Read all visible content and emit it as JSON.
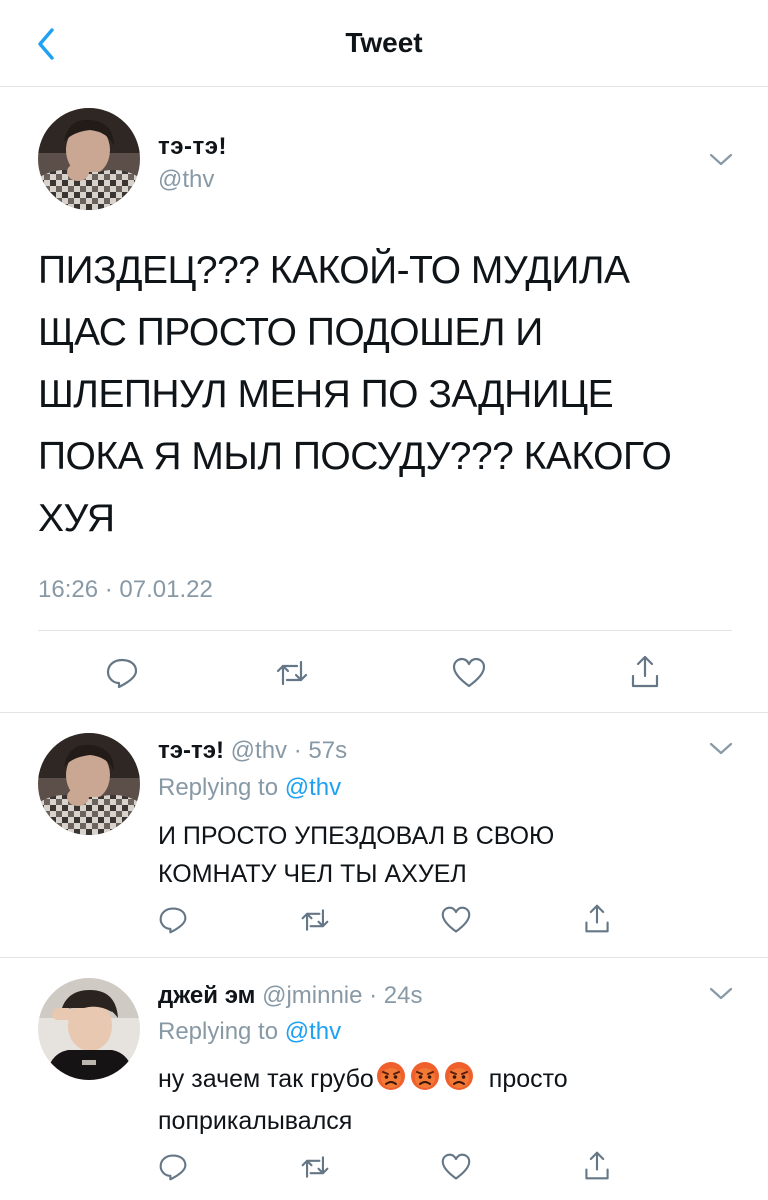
{
  "header": {
    "title": "Tweet"
  },
  "main_tweet": {
    "name": "тэ-тэ!",
    "handle": "@thv",
    "lines": [
      "ПИЗДЕЦ??? КАКОЙ-ТО МУДИЛА",
      "ЩАС ПРОСТО ПОДОШЕЛ И",
      "ШЛЕПНУЛ МЕНЯ ПО ЗАДНИЦЕ",
      "ПОКА Я МЫЛ ПОСУДУ??? КАКОГО",
      "ХУЯ"
    ],
    "meta": "16:26 · 07.01.22"
  },
  "replies": [
    {
      "name": "тэ-тэ!",
      "handle_time": "@thv · 57s",
      "replying_label": "Replying to",
      "replying_to": "@thv",
      "lines": [
        "И ПРОСТО УПЕЗДОВАЛ В СВОЮ",
        "КОМНАТУ ЧЕЛ ТЫ АХУЕЛ"
      ]
    },
    {
      "name": "джей эм",
      "handle_time": "@jminnie · 24s",
      "replying_label": "Replying to",
      "replying_to": "@thv",
      "line1_before": "ну зачем так грубо",
      "emojis": [
        "angry-face-emoji",
        "angry-face-emoji",
        "angry-face-emoji"
      ],
      "line1_after": "просто",
      "line2": "поприкалывался"
    }
  ],
  "colors": {
    "accent": "#1da1f2",
    "secondary": "#8899a6",
    "icon": "#657786",
    "divider": "#e1e5e8"
  }
}
